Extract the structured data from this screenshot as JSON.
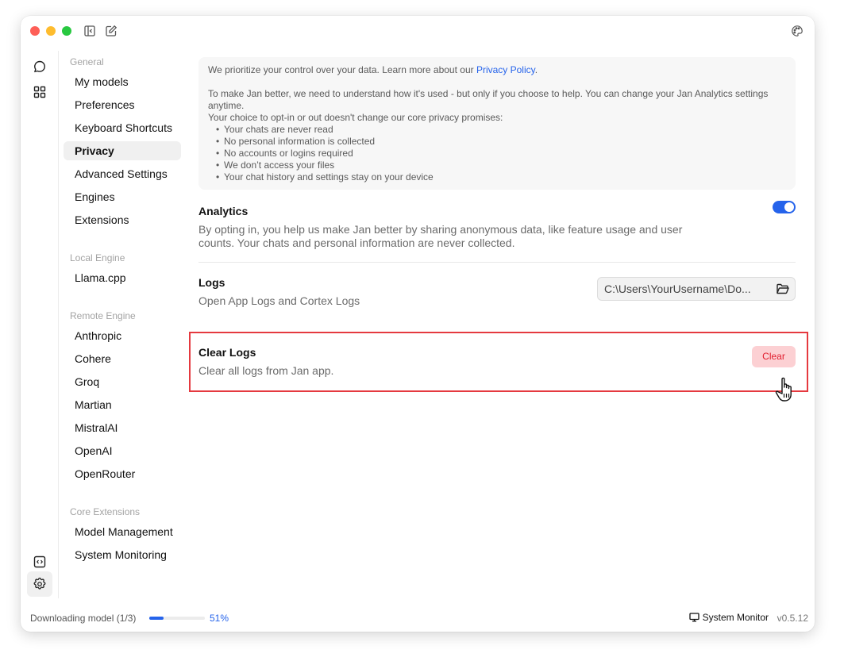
{
  "window": {
    "titlebar": {
      "icons": [
        "toggle-sidebar-icon",
        "compose-icon",
        "palette-icon"
      ]
    }
  },
  "ribbon": {
    "items": [
      {
        "name": "chat",
        "icon": "chat-bubble-icon"
      },
      {
        "name": "hub",
        "icon": "grid-icon"
      },
      {
        "name": "local-api",
        "icon": "code-icon"
      },
      {
        "name": "settings",
        "icon": "gear-icon",
        "active": true
      }
    ]
  },
  "sidebar": {
    "groups": [
      {
        "title": "General",
        "items": [
          "My models",
          "Preferences",
          "Keyboard Shortcuts",
          "Privacy",
          "Advanced Settings",
          "Engines",
          "Extensions"
        ]
      },
      {
        "title": "Local Engine",
        "items": [
          "Llama.cpp"
        ]
      },
      {
        "title": "Remote Engine",
        "items": [
          "Anthropic",
          "Cohere",
          "Groq",
          "Martian",
          "MistralAI",
          "OpenAI",
          "OpenRouter"
        ]
      },
      {
        "title": "Core Extensions",
        "items": [
          "Model Management",
          "System Monitoring"
        ]
      }
    ],
    "active_item": "Privacy"
  },
  "notice": {
    "line1_prefix": "We prioritize your control over your data. Learn more about our ",
    "line1_link": "Privacy Policy",
    "line1_suffix": ".",
    "line2": "To make Jan better, we need to understand how it's used - but only if you choose to help. You can change your Jan Analytics settings anytime.",
    "line3": "Your choice to opt-in or out doesn't change our core privacy promises:",
    "promises": [
      "Your chats are never read",
      "No personal information is collected",
      "No accounts or logins required",
      "We don’t access your files",
      "Your chat history and settings stay on your device"
    ]
  },
  "analytics": {
    "title": "Analytics",
    "description": "By opting in, you help us make Jan better by sharing anonymous data, like feature usage and user counts. Your chats and personal information are never collected.",
    "enabled": true,
    "accent_color": "#2563eb"
  },
  "logs": {
    "title": "Logs",
    "description": "Open App Logs and Cortex Logs",
    "path": "C:\\Users\\YourUsername\\Do...",
    "folder_icon": "folder-open-icon"
  },
  "clear_logs": {
    "title": "Clear Logs",
    "description": "Clear all logs from Jan app.",
    "button_label": "Clear",
    "highlight_color": "#e5393f"
  },
  "statusbar": {
    "download_label": "Downloading model (1/3)",
    "download_progress_percent": 51,
    "download_progress_display": 0.25,
    "download_percent_label": "51%",
    "system_monitor_label": "System Monitor",
    "version": "v0.5.12"
  }
}
